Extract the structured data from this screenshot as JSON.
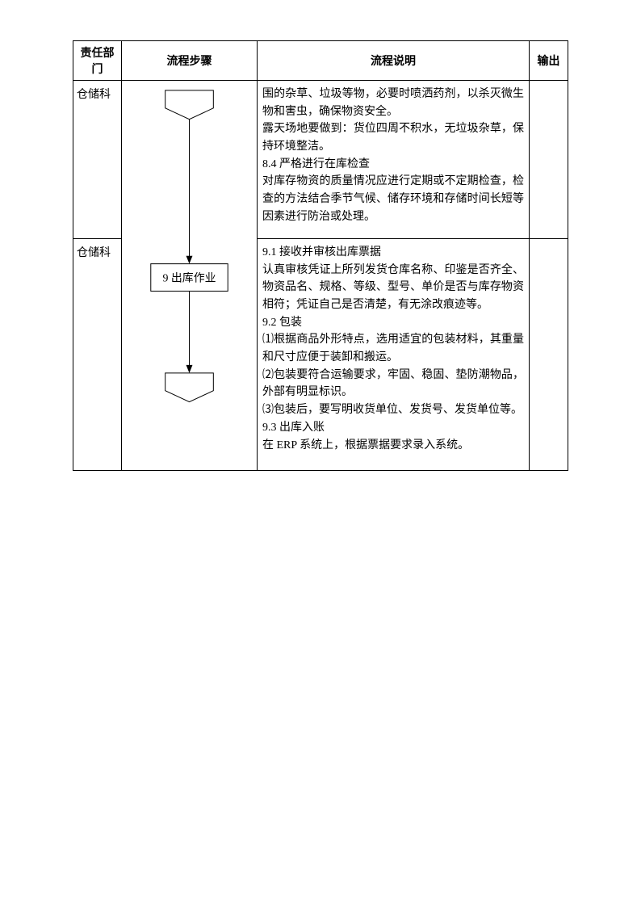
{
  "headers": {
    "dept": "责任部门",
    "step": "流程步骤",
    "desc": "流程说明",
    "out": "输出"
  },
  "rows": [
    {
      "dept": "仓储科",
      "desc": "围的杂草、垃圾等物，必要时喷洒药剂，以杀灭微生物和害虫，确保物资安全。\n露天场地要做到：货位四周不积水，无垃圾杂草，保持环境整洁。\n8.4 严格进行在库检查\n对库存物资的质量情况应进行定期或不定期检查，检查的方法结合季节气候、储存环境和存储时间长短等因素进行防治或处理。"
    },
    {
      "dept": "仓储科",
      "step_label": "9 出库作业",
      "desc": "9.1 接收并审核出库票据\n认真审核凭证上所列发货仓库名称、印鉴是否齐全、物资品名、规格、等级、型号、单价是否与库存物资相符；凭证自己是否清楚，有无涂改痕迹等。\n9.2 包装\n⑴根据商品外形特点，选用适宜的包装材料，其重量和尺寸应便于装卸和搬运。\n⑵包装要符合运输要求，牢固、稳固、垫防潮物品，外部有明显标识。\n⑶包装后，要写明收货单位、发货号、发货单位等。\n9.3 出库入账\n在 ERP 系统上，根据票据要求录入系统。"
    }
  ]
}
